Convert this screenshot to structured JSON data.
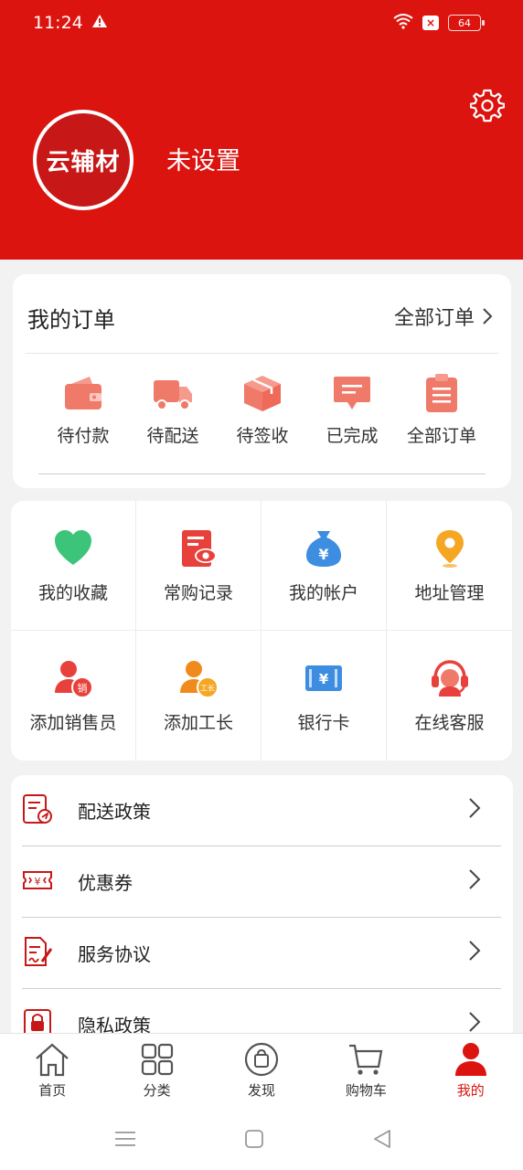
{
  "status_bar": {
    "time": "11:24",
    "battery": "64"
  },
  "profile": {
    "avatar_text": "云辅材",
    "nickname": "未设置"
  },
  "orders": {
    "title": "我的订单",
    "all_label": "全部订单",
    "items": [
      {
        "label": "待付款",
        "icon": "wallet-icon"
      },
      {
        "label": "待配送",
        "icon": "truck-icon"
      },
      {
        "label": "待签收",
        "icon": "package-icon"
      },
      {
        "label": "已完成",
        "icon": "message-done-icon"
      },
      {
        "label": "全部订单",
        "icon": "clipboard-icon"
      }
    ]
  },
  "services": [
    {
      "label": "我的收藏",
      "icon": "heart-icon"
    },
    {
      "label": "常购记录",
      "icon": "document-eye-icon"
    },
    {
      "label": "我的帐户",
      "icon": "money-bag-icon"
    },
    {
      "label": "地址管理",
      "icon": "location-pin-icon"
    },
    {
      "label": "添加销售员",
      "icon": "add-salesperson-icon"
    },
    {
      "label": "添加工长",
      "icon": "add-foreman-icon"
    },
    {
      "label": "银行卡",
      "icon": "bank-card-icon"
    },
    {
      "label": "在线客服",
      "icon": "customer-service-icon"
    }
  ],
  "menu": [
    {
      "label": "配送政策",
      "icon": "delivery-policy-icon"
    },
    {
      "label": "优惠券",
      "icon": "coupon-icon"
    },
    {
      "label": "服务协议",
      "icon": "agreement-icon"
    },
    {
      "label": "隐私政策",
      "icon": "privacy-lock-icon"
    }
  ],
  "tabbar": [
    {
      "label": "首页",
      "icon": "home-icon"
    },
    {
      "label": "分类",
      "icon": "category-icon"
    },
    {
      "label": "发现",
      "icon": "discover-icon"
    },
    {
      "label": "购物车",
      "icon": "cart-icon"
    },
    {
      "label": "我的",
      "icon": "profile-icon",
      "active": true
    }
  ],
  "colors": {
    "brand": "#dc140f",
    "accent_orange": "#f07a6a",
    "heart": "#3cc57a",
    "blue": "#3d8de0",
    "gold": "#f5a623"
  }
}
